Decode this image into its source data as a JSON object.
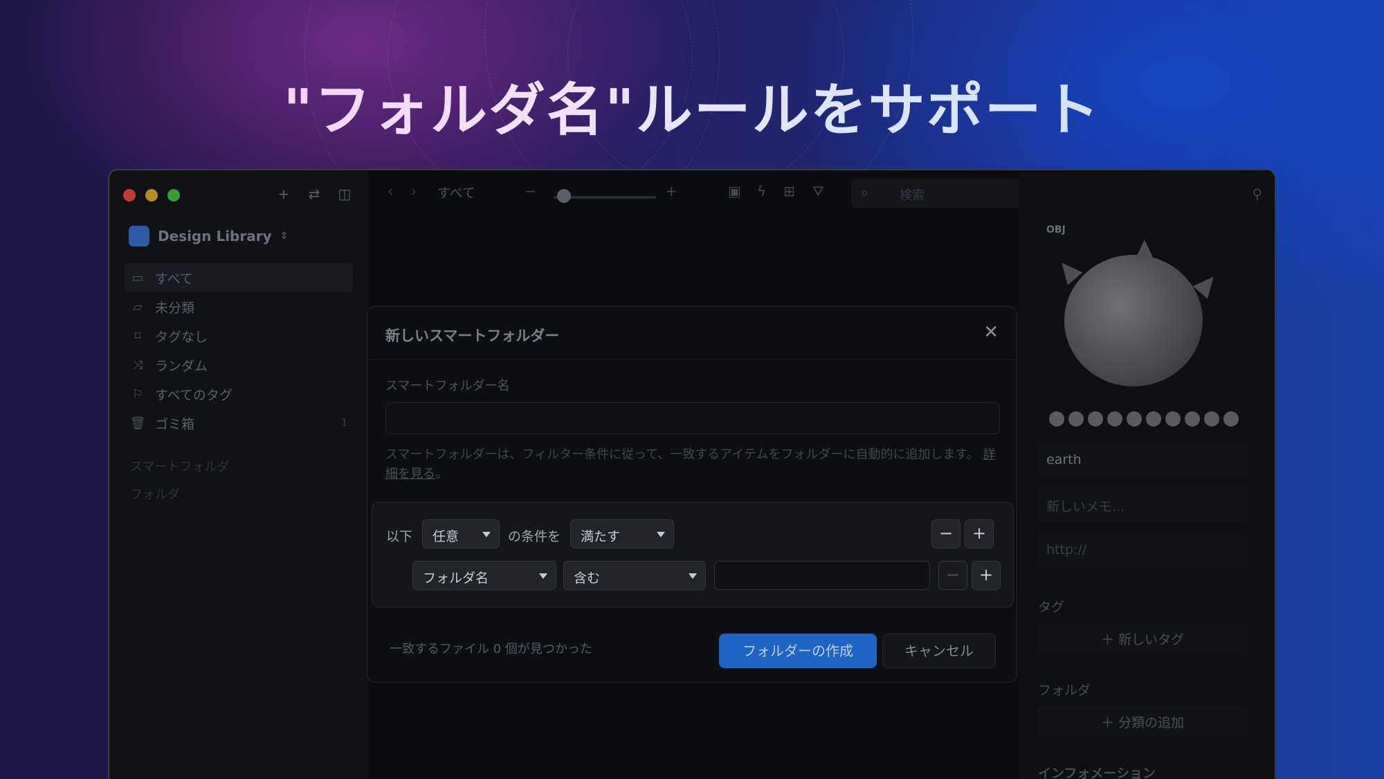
{
  "headline": "\"フォルダ名\"ルールをサポート",
  "sidebar": {
    "library_name": "Design Library",
    "items": [
      {
        "label": "すべて",
        "count": ""
      },
      {
        "label": "未分類",
        "count": ""
      },
      {
        "label": "タグなし",
        "count": ""
      },
      {
        "label": "ランダム",
        "count": ""
      },
      {
        "label": "すべてのタグ",
        "count": ""
      },
      {
        "label": "ゴミ箱",
        "count": "1"
      }
    ],
    "sections": [
      "スマートフォルダ",
      "フォルダ"
    ]
  },
  "toolbar": {
    "breadcrumb": "すべて",
    "search_placeholder": "検索",
    "zoom_level": 0.1
  },
  "inspector": {
    "preview_tag": "OBJ",
    "name_value": "earth",
    "memo_placeholder": "新しいメモ...",
    "url_placeholder": "http://",
    "tags_heading": "タグ",
    "new_tag": "新しいタグ",
    "folder_heading": "フォルダ",
    "add_category": "分類の追加",
    "info_heading": "インフォメーション"
  },
  "modal": {
    "title": "新しいスマートフォルダー",
    "name_label": "スマートフォルダー名",
    "name_value": "",
    "description": "スマートフォルダーは、フィルター条件に従って、一致するアイテムをフォルダーに自動的に追加します。",
    "learn_more": "詳細を見る",
    "desc_end": "。",
    "rules": {
      "prefix": "以下",
      "match_mode": "任意",
      "middle": "の条件を",
      "satisfy": "満たす",
      "field": "フォルダ名",
      "operator": "含む",
      "value": ""
    },
    "found_text": "一致するファイル 0 個が見つかった",
    "create_button": "フォルダーの作成",
    "cancel_button": "キャンセル"
  },
  "colors": {
    "primary_button": "#1f63c4",
    "traffic_red": "#c43b32",
    "traffic_yellow": "#b78a22",
    "traffic_green": "#3a9b3a"
  }
}
